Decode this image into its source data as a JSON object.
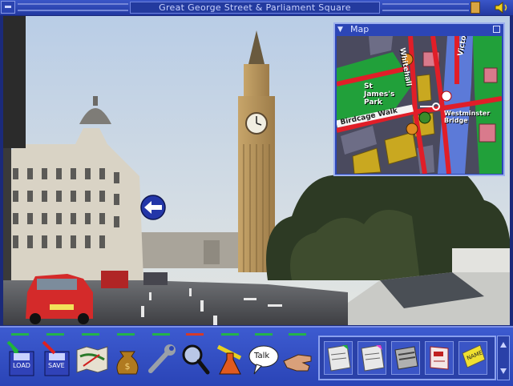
{
  "window": {
    "title": "Great George Street & Parliament Square"
  },
  "map": {
    "title": "Map",
    "labels": {
      "park": "St James's Park",
      "whitehall": "Whitehall",
      "victoria": "Victoria",
      "birdcage": "Birdcage Walk",
      "bridge": "Westminster Bridge"
    }
  },
  "toolbar": {
    "load_label": "LOAD",
    "save_label": "SAVE",
    "talk_label": "Talk",
    "tools": [
      "load",
      "save",
      "map",
      "money-bag",
      "spanner",
      "magnifying-glass",
      "chemistry-flask",
      "talk",
      "hand"
    ],
    "active_tool": "magnifying-glass"
  },
  "inventory": {
    "items": [
      "green-card",
      "pink-card",
      "newspaper",
      "red-document",
      "name-badge"
    ],
    "badge_text": "NAME"
  },
  "colors": {
    "chrome": "#2a44b6",
    "indicator": "#24b24a",
    "indicator_active": "#d53a2a"
  }
}
